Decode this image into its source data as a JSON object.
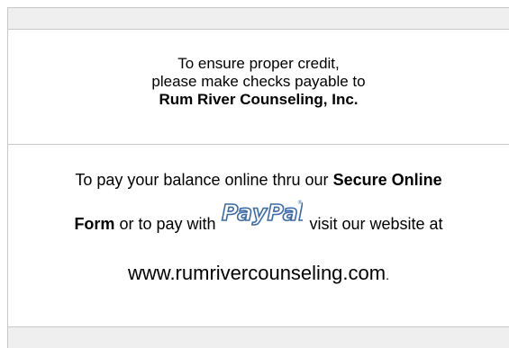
{
  "checks_section": {
    "line1": "To ensure proper credit,",
    "line2": "please make checks payable to",
    "payee": "Rum River Counseling, Inc."
  },
  "online_section": {
    "line1_prefix": "To pay your balance online thru our ",
    "secure_online": "Secure Online",
    "form_word": "Form",
    "line2_middle": " or to pay with",
    "paypal_logo_text": "PayPal",
    "line2_suffix": "visit our website at",
    "website": "www.rumrivercounseling.com",
    "website_period": "."
  },
  "colors": {
    "paypal_blue": "#3b6aa6",
    "band_gray": "#efefef",
    "rule_gray": "#c8c8c8"
  },
  "icons": {
    "paypal": "paypal-logo-icon"
  }
}
